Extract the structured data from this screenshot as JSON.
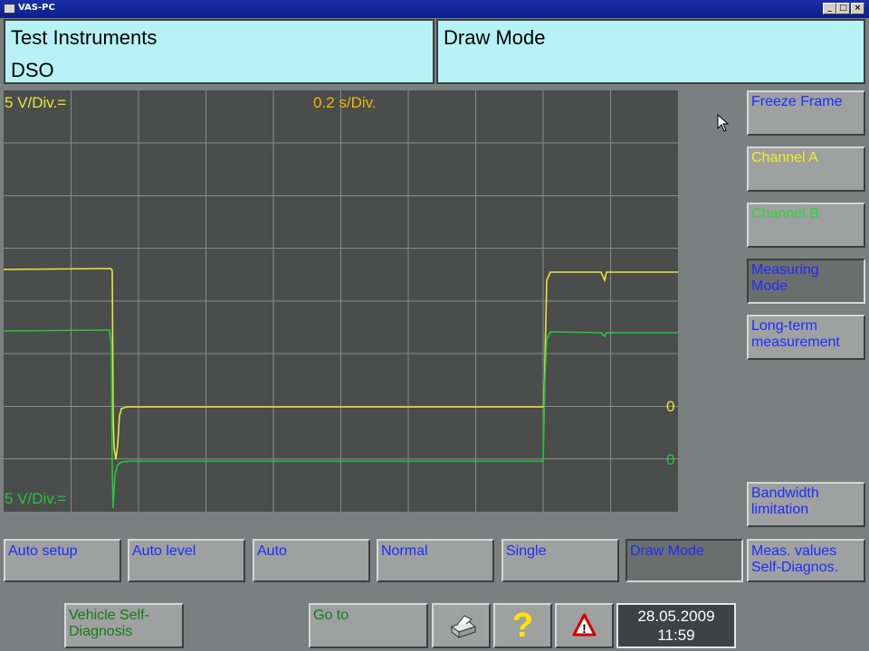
{
  "window": {
    "title": "VAS-PC",
    "controls": [
      "_",
      "□",
      "×"
    ]
  },
  "header": {
    "left_line1": "Test Instruments",
    "left_line2": "DSO",
    "right_title": "Draw Mode"
  },
  "scope": {
    "channel_a_scale": "5 V/Div.=",
    "channel_b_scale": "5 V/Div.=",
    "time_base": "0.2 s/Div.",
    "channel_a_zero": "0",
    "channel_b_zero": "0",
    "colors": {
      "background": "#4b4c4c",
      "grid": "#8a8c8c",
      "channel_a": "#e8e63a",
      "channel_b": "#23c83a",
      "timebase_text": "#f0b800"
    }
  },
  "side_buttons": [
    {
      "line1": "Freeze Frame",
      "line2": ""
    },
    {
      "line1": "Channel A",
      "line2": ""
    },
    {
      "line1": "Channel B",
      "line2": ""
    },
    {
      "line1": "Measuring",
      "line2": "Mode"
    },
    {
      "line1": "Long-term",
      "line2": "measurement"
    },
    {
      "line1": "Bandwidth",
      "line2": "limitation"
    }
  ],
  "bottom_buttons": [
    {
      "line1": "Auto setup",
      "line2": ""
    },
    {
      "line1": "Auto level",
      "line2": ""
    },
    {
      "line1": "Auto",
      "line2": ""
    },
    {
      "line1": "Normal",
      "line2": ""
    },
    {
      "line1": "Single",
      "line2": ""
    },
    {
      "line1": "Draw Mode",
      "line2": ""
    },
    {
      "line1": "Meas. values",
      "line2": "Self-Diagnos."
    }
  ],
  "footer": {
    "vehicle_line1": "Vehicle  Self-",
    "vehicle_line2": "Diagnosis",
    "goto_label": "Go to",
    "print_icon": "printer-icon",
    "help_glyph": "?",
    "warning_glyph": "!",
    "date": "28.05.2009",
    "time": "11:59"
  }
}
